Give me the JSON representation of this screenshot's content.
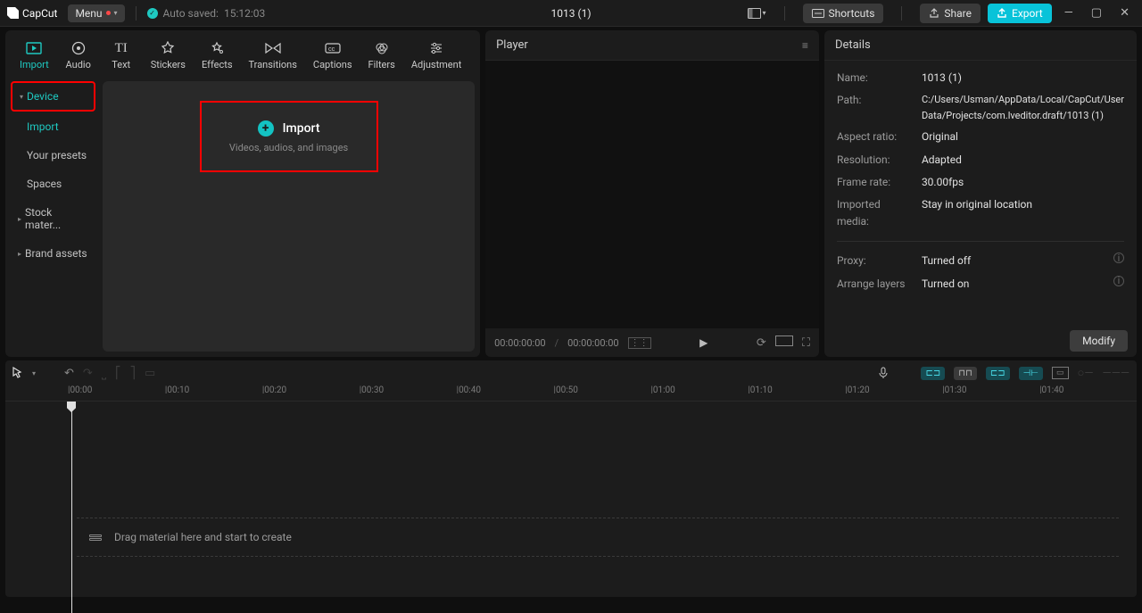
{
  "titlebar": {
    "app_name": "CapCut",
    "menu_label": "Menu",
    "auto_saved_label": "Auto saved:",
    "auto_saved_time": "15:12:03",
    "project_title": "1013 (1)",
    "shortcuts_label": "Shortcuts",
    "share_label": "Share",
    "export_label": "Export"
  },
  "tabs": {
    "import": "Import",
    "audio": "Audio",
    "text": "Text",
    "stickers": "Stickers",
    "effects": "Effects",
    "transitions": "Transitions",
    "captions": "Captions",
    "filters": "Filters",
    "adjustment": "Adjustment"
  },
  "sidebar": {
    "device": "Device",
    "import": "Import",
    "presets": "Your presets",
    "spaces": "Spaces",
    "stock": "Stock mater...",
    "brand": "Brand assets"
  },
  "import_box": {
    "title": "Import",
    "subtitle": "Videos, audios, and images"
  },
  "player": {
    "title": "Player",
    "time_current": "00:00:00:00",
    "time_total": "00:00:00:00"
  },
  "details": {
    "title": "Details",
    "rows": {
      "name_label": "Name:",
      "name_val": "1013 (1)",
      "path_label": "Path:",
      "path_val": "C:/Users/Usman/AppData/Local/CapCut/User Data/Projects/com.lveditor.draft/1013 (1)",
      "aspect_label": "Aspect ratio:",
      "aspect_val": "Original",
      "res_label": "Resolution:",
      "res_val": "Adapted",
      "fps_label": "Frame rate:",
      "fps_val": "30.00fps",
      "media_label": "Imported media:",
      "media_val": "Stay in original location",
      "proxy_label": "Proxy:",
      "proxy_val": "Turned off",
      "layers_label": "Arrange layers",
      "layers_val": "Turned on"
    },
    "modify_label": "Modify"
  },
  "timeline": {
    "labels": [
      "00:00",
      "00:10",
      "00:20",
      "00:30",
      "00:40",
      "00:50",
      "01:00",
      "01:10",
      "01:20",
      "01:30",
      "01:40"
    ],
    "drop_hint": "Drag material here and start to create"
  }
}
